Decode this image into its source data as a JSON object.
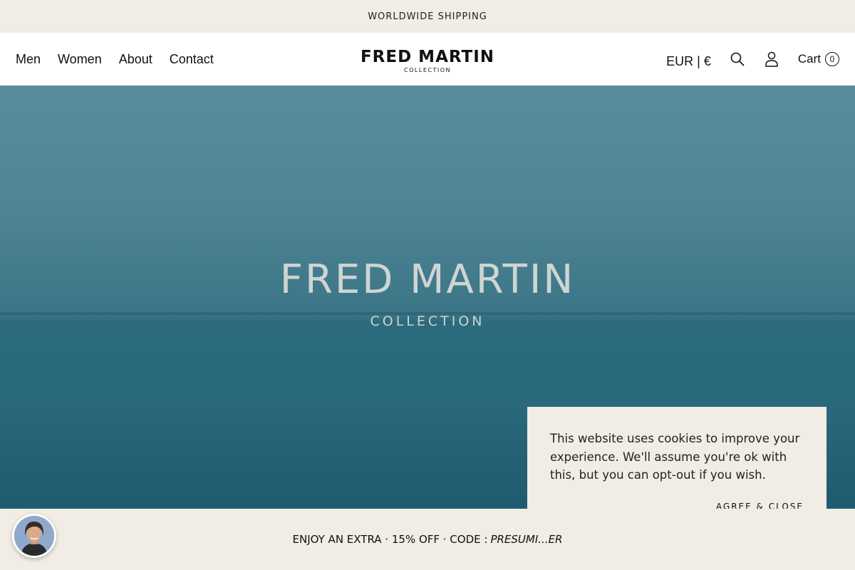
{
  "announcement": {
    "text": "WORLDWIDE SHIPPING"
  },
  "nav": {
    "items": [
      {
        "label": "Men"
      },
      {
        "label": "Women"
      },
      {
        "label": "About"
      },
      {
        "label": "Contact"
      }
    ]
  },
  "logo": {
    "line1": "FRED MARTIN",
    "line2": "COLLECTION"
  },
  "header_right": {
    "currency": "EUR | €",
    "search_icon": "search-icon",
    "account_icon": "user-icon",
    "cart_label": "Cart",
    "cart_count": "0"
  },
  "hero": {
    "title": "FRED MARTIN",
    "subtitle": "COLLECTION"
  },
  "cookie": {
    "message": "This website uses cookies to improve your experience. We'll assume you're ok with this, but you can opt-out if you wish.",
    "button": "AGREE & CLOSE"
  },
  "promo": {
    "text": "ENJOY AN EXTRA · 15% OFF · CODE :",
    "code": "PRESUMI...ER"
  },
  "chat": {
    "icon": "chat-agent-avatar"
  },
  "colors": {
    "beige": "#f1ece4",
    "sea": "#3b7587"
  }
}
